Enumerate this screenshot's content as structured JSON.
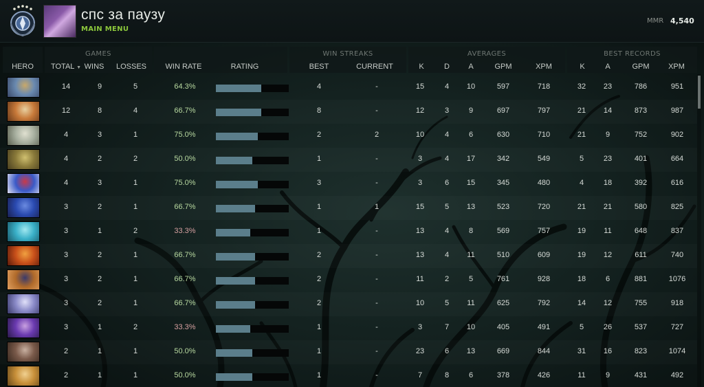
{
  "header": {
    "player_name": "спс за паузу",
    "sub_link": "MAIN MENU",
    "mmr_label": "MMR",
    "mmr_value": "4,540"
  },
  "groups": {
    "games": "GAMES",
    "win_streaks": "WIN STREAKS",
    "averages": "AVERAGES",
    "best_records": "BEST RECORDS"
  },
  "columns": {
    "hero": "HERO",
    "total": "TOTAL",
    "wins": "WINS",
    "losses": "LOSSES",
    "win_rate": "WIN RATE",
    "rating": "RATING",
    "best": "BEST",
    "current": "CURRENT",
    "avg_k": "K",
    "avg_d": "D",
    "avg_a": "A",
    "avg_gpm": "GPM",
    "avg_xpm": "XPM",
    "rec_k": "K",
    "rec_a": "A",
    "rec_gpm": "GPM",
    "rec_xpm": "XPM"
  },
  "colors": {
    "accent_green": "#8cc83c",
    "rating_bar": "#5b7e8b",
    "good_winrate": "#b8d9a0",
    "bad_winrate": "#d6a0a0"
  },
  "rows": [
    {
      "total": "14",
      "wins": "9",
      "losses": "5",
      "wr": "64.3%",
      "rating": 0.62,
      "best": "4",
      "current": "-",
      "k": "15",
      "d": "4",
      "a": "10",
      "gpm": "597",
      "xpm": "718",
      "rk": "32",
      "ra": "23",
      "rgpm": "786",
      "rxpm": "951",
      "hero_colors": [
        "#6a8ab0",
        "#c8a86a",
        "#3a4a6a"
      ]
    },
    {
      "total": "12",
      "wins": "8",
      "losses": "4",
      "wr": "66.7%",
      "rating": 0.62,
      "best": "8",
      "current": "-",
      "k": "12",
      "d": "3",
      "a": "9",
      "gpm": "697",
      "xpm": "797",
      "rk": "21",
      "ra": "14",
      "rgpm": "873",
      "rxpm": "987",
      "hero_colors": [
        "#c87a3a",
        "#e8d0a0",
        "#6a3a1a"
      ]
    },
    {
      "total": "4",
      "wins": "3",
      "losses": "1",
      "wr": "75.0%",
      "rating": 0.58,
      "best": "2",
      "current": "2",
      "k": "10",
      "d": "4",
      "a": "6",
      "gpm": "630",
      "xpm": "710",
      "rk": "21",
      "ra": "9",
      "rgpm": "752",
      "rxpm": "902",
      "hero_colors": [
        "#a8b0a0",
        "#e0e0d0",
        "#5a6050"
      ]
    },
    {
      "total": "4",
      "wins": "2",
      "losses": "2",
      "wr": "50.0%",
      "rating": 0.5,
      "best": "1",
      "current": "-",
      "k": "3",
      "d": "4",
      "a": "17",
      "gpm": "342",
      "xpm": "549",
      "rk": "5",
      "ra": "23",
      "rgpm": "401",
      "rxpm": "664",
      "hero_colors": [
        "#8a7a3a",
        "#d0c070",
        "#4a4020"
      ]
    },
    {
      "total": "4",
      "wins": "3",
      "losses": "1",
      "wr": "75.0%",
      "rating": 0.58,
      "best": "3",
      "current": "-",
      "k": "3",
      "d": "6",
      "a": "15",
      "gpm": "345",
      "xpm": "480",
      "rk": "4",
      "ra": "18",
      "rgpm": "392",
      "rxpm": "616",
      "hero_colors": [
        "#3a5ac8",
        "#c83a4a",
        "#e0e0f0"
      ]
    },
    {
      "total": "3",
      "wins": "2",
      "losses": "1",
      "wr": "66.7%",
      "rating": 0.54,
      "best": "1",
      "current": "1",
      "k": "15",
      "d": "5",
      "a": "13",
      "gpm": "523",
      "xpm": "720",
      "rk": "21",
      "ra": "21",
      "rgpm": "580",
      "rxpm": "825",
      "hero_colors": [
        "#2a4ab0",
        "#6a8ae0",
        "#1a2050"
      ]
    },
    {
      "total": "3",
      "wins": "1",
      "losses": "2",
      "wr": "33.3%",
      "rating": 0.47,
      "best": "1",
      "current": "-",
      "k": "13",
      "d": "4",
      "a": "8",
      "gpm": "569",
      "xpm": "757",
      "rk": "19",
      "ra": "11",
      "rgpm": "648",
      "rxpm": "837",
      "hero_colors": [
        "#3ab0c8",
        "#a0e8f0",
        "#1a5a6a"
      ]
    },
    {
      "total": "3",
      "wins": "2",
      "losses": "1",
      "wr": "66.7%",
      "rating": 0.54,
      "best": "2",
      "current": "-",
      "k": "13",
      "d": "4",
      "a": "11",
      "gpm": "510",
      "xpm": "609",
      "rk": "19",
      "ra": "12",
      "rgpm": "611",
      "rxpm": "740",
      "hero_colors": [
        "#c8501a",
        "#f0a040",
        "#5a1a0a"
      ]
    },
    {
      "total": "3",
      "wins": "2",
      "losses": "1",
      "wr": "66.7%",
      "rating": 0.54,
      "best": "2",
      "current": "-",
      "k": "11",
      "d": "2",
      "a": "5",
      "gpm": "761",
      "xpm": "928",
      "rk": "18",
      "ra": "6",
      "rgpm": "881",
      "rxpm": "1076",
      "hero_colors": [
        "#b06a2a",
        "#3a3a6a",
        "#e0a060"
      ]
    },
    {
      "total": "3",
      "wins": "2",
      "losses": "1",
      "wr": "66.7%",
      "rating": 0.54,
      "best": "2",
      "current": "-",
      "k": "10",
      "d": "5",
      "a": "11",
      "gpm": "625",
      "xpm": "792",
      "rk": "14",
      "ra": "12",
      "rgpm": "755",
      "rxpm": "918",
      "hero_colors": [
        "#8a8ac8",
        "#e0e0f8",
        "#3a3a6a"
      ]
    },
    {
      "total": "3",
      "wins": "1",
      "losses": "2",
      "wr": "33.3%",
      "rating": 0.47,
      "best": "1",
      "current": "-",
      "k": "3",
      "d": "7",
      "a": "10",
      "gpm": "405",
      "xpm": "491",
      "rk": "5",
      "ra": "26",
      "rgpm": "537",
      "rxpm": "727",
      "hero_colors": [
        "#6a3ab0",
        "#c8a0e0",
        "#2a1a4a"
      ]
    },
    {
      "total": "2",
      "wins": "1",
      "losses": "1",
      "wr": "50.0%",
      "rating": 0.5,
      "best": "1",
      "current": "-",
      "k": "23",
      "d": "6",
      "a": "13",
      "gpm": "669",
      "xpm": "844",
      "rk": "31",
      "ra": "16",
      "rgpm": "823",
      "rxpm": "1074",
      "hero_colors": [
        "#7a5a4a",
        "#c8b0a0",
        "#3a2a20"
      ]
    },
    {
      "total": "2",
      "wins": "1",
      "losses": "1",
      "wr": "50.0%",
      "rating": 0.5,
      "best": "1",
      "current": "-",
      "k": "7",
      "d": "8",
      "a": "6",
      "gpm": "378",
      "xpm": "426",
      "rk": "11",
      "ra": "9",
      "rgpm": "431",
      "rxpm": "492",
      "hero_colors": [
        "#c8903a",
        "#f0d090",
        "#6a4a1a"
      ]
    }
  ]
}
